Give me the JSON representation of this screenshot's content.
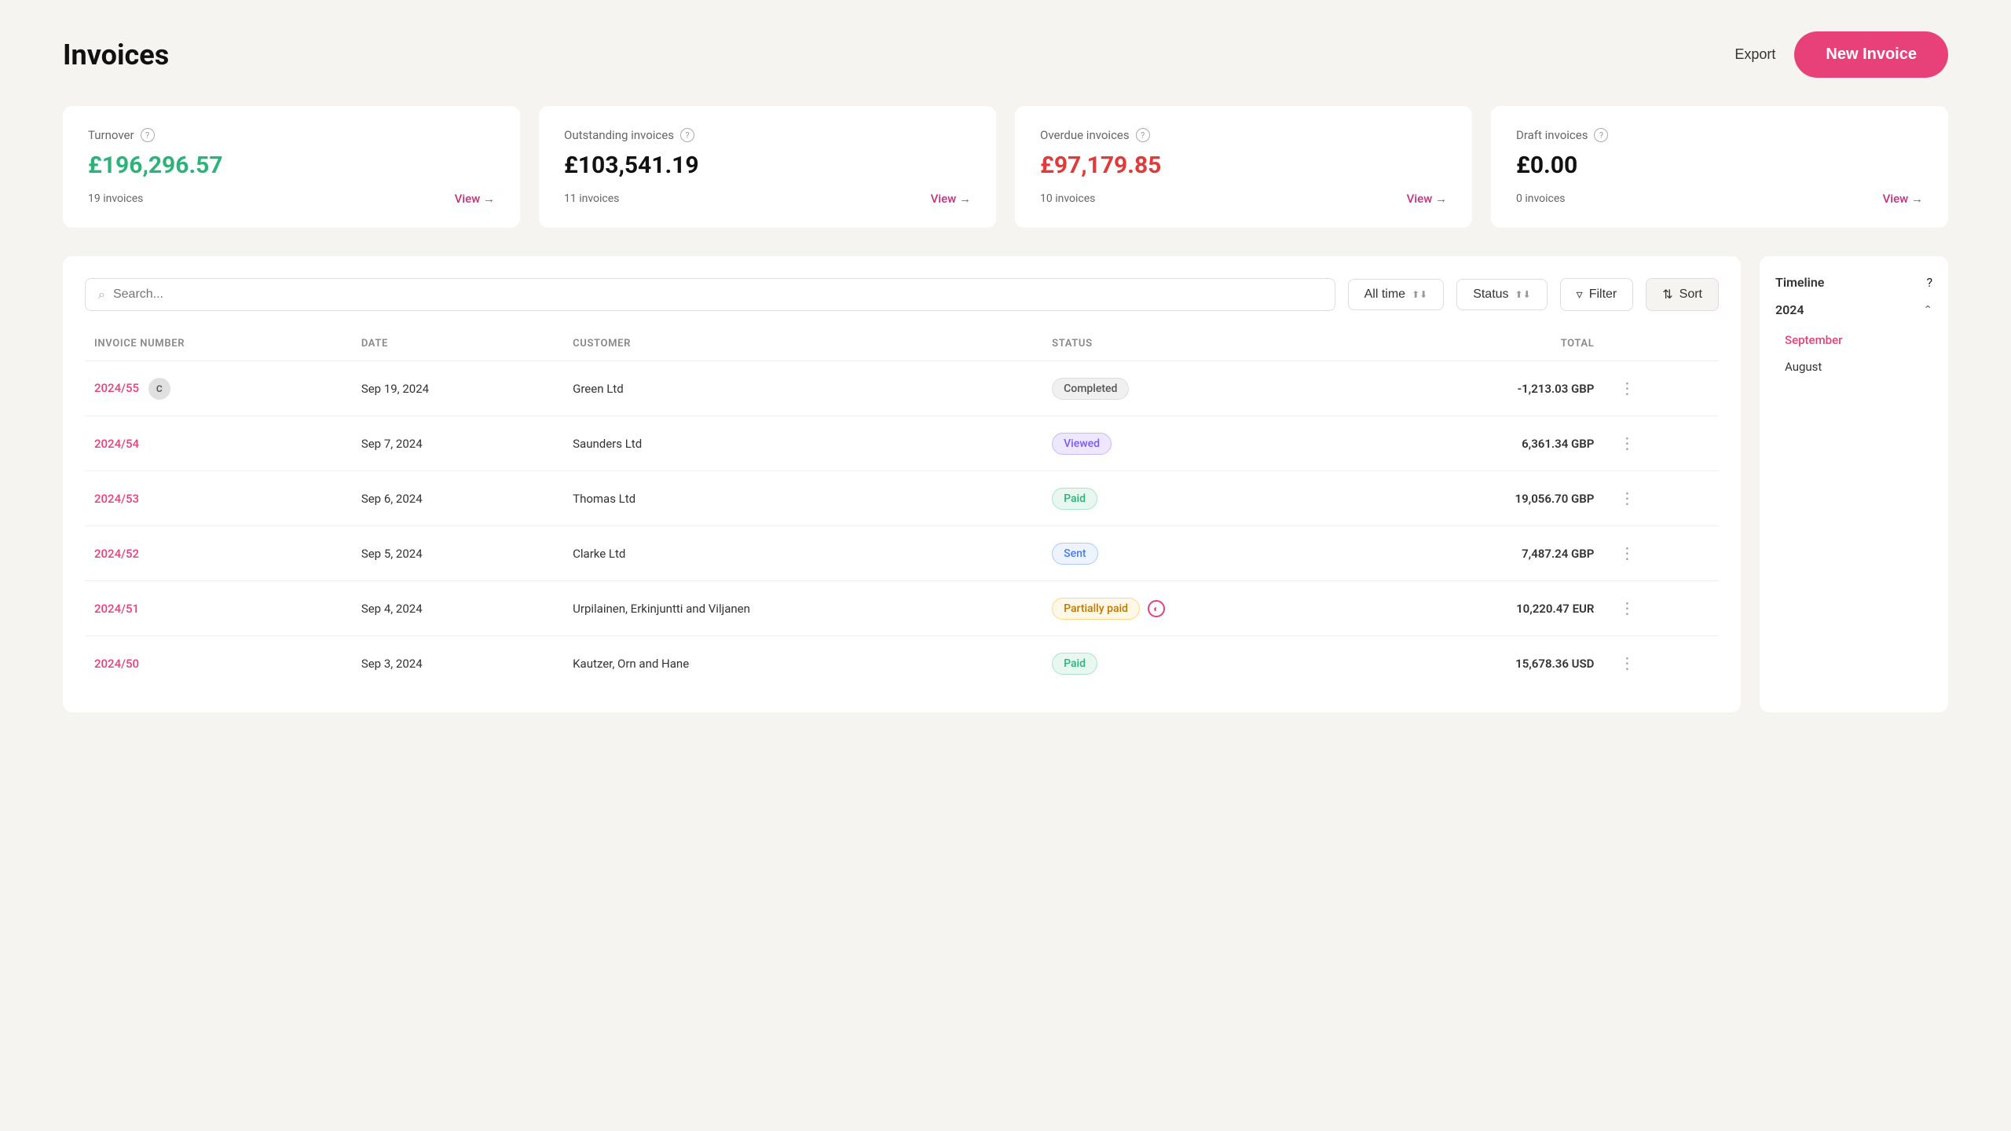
{
  "header": {
    "title": "Invoices",
    "export_label": "Export",
    "new_invoice_label": "New Invoice"
  },
  "summary_cards": [
    {
      "id": "turnover",
      "label": "Turnover",
      "value": "£196,296.57",
      "value_class": "green",
      "count": "19 invoices",
      "link": "View →"
    },
    {
      "id": "outstanding",
      "label": "Outstanding invoices",
      "value": "£103,541.19",
      "value_class": "black",
      "count": "11 invoices",
      "link": "View →"
    },
    {
      "id": "overdue",
      "label": "Overdue invoices",
      "value": "£97,179.85",
      "value_class": "red",
      "count": "10 invoices",
      "link": "View →"
    },
    {
      "id": "draft",
      "label": "Draft invoices",
      "value": "£0.00",
      "value_class": "black",
      "count": "0 invoices",
      "link": "View →"
    }
  ],
  "toolbar": {
    "search_placeholder": "Search...",
    "time_filter": "All time",
    "status_filter": "Status",
    "filter_label": "Filter",
    "sort_label": "Sort"
  },
  "table": {
    "columns": [
      "INVOICE NUMBER",
      "DATE",
      "CUSTOMER",
      "STATUS",
      "TOTAL"
    ],
    "rows": [
      {
        "id": "2024/55",
        "date": "Sep 19, 2024",
        "customer": "Green Ltd",
        "customer_avatar": "C",
        "status": "Completed",
        "status_class": "badge-completed",
        "total": "-1,213.03 GBP",
        "has_clock": false
      },
      {
        "id": "2024/54",
        "date": "Sep 7, 2024",
        "customer": "Saunders Ltd",
        "customer_avatar": null,
        "status": "Viewed",
        "status_class": "badge-viewed",
        "total": "6,361.34 GBP",
        "has_clock": false
      },
      {
        "id": "2024/53",
        "date": "Sep 6, 2024",
        "customer": "Thomas Ltd",
        "customer_avatar": null,
        "status": "Paid",
        "status_class": "badge-paid",
        "total": "19,056.70 GBP",
        "has_clock": false
      },
      {
        "id": "2024/52",
        "date": "Sep 5, 2024",
        "customer": "Clarke Ltd",
        "customer_avatar": null,
        "status": "Sent",
        "status_class": "badge-sent",
        "total": "7,487.24 GBP",
        "has_clock": false
      },
      {
        "id": "2024/51",
        "date": "Sep 4, 2024",
        "customer": "Urpilainen, Erkinjuntti and Viljanen",
        "customer_avatar": null,
        "status": "Partially paid",
        "status_class": "badge-partial",
        "total": "10,220.47 EUR",
        "has_clock": true
      },
      {
        "id": "2024/50",
        "date": "Sep 3, 2024",
        "customer": "Kautzer, Orn and Hane",
        "customer_avatar": null,
        "status": "Paid",
        "status_class": "badge-paid",
        "total": "15,678.36 USD",
        "has_clock": false
      }
    ]
  },
  "timeline": {
    "title": "Timeline",
    "year": "2024",
    "months": [
      {
        "label": "September",
        "active": true
      },
      {
        "label": "August",
        "active": false
      }
    ]
  }
}
